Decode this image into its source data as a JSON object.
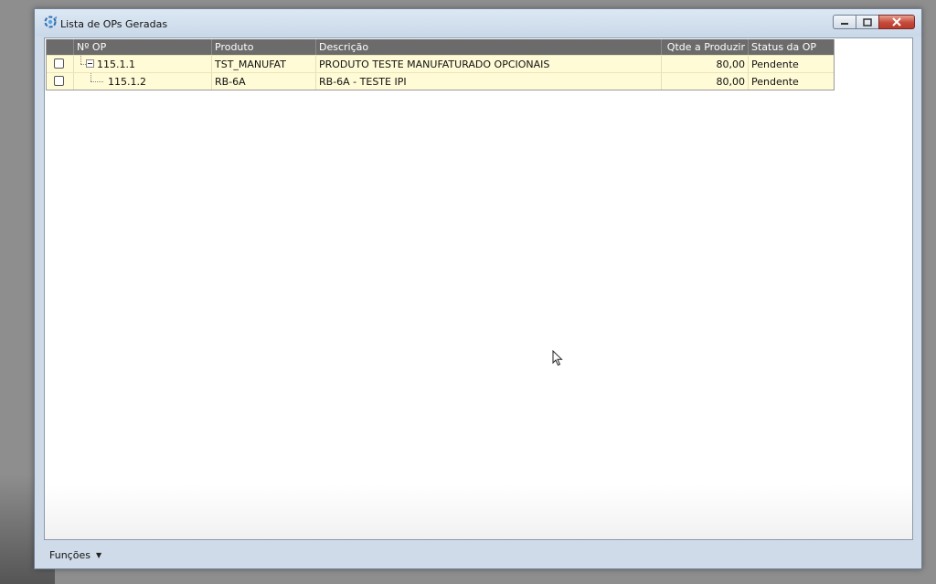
{
  "window": {
    "title": "Lista de OPs Geradas",
    "icon": "gear-refresh-icon"
  },
  "grid": {
    "columns": [
      "Nº OP",
      "Produto",
      "Descrição",
      "Qtde a Produzir",
      "Status da OP"
    ],
    "rows": [
      {
        "op": "115.1.1",
        "produto": "TST_MANUFAT",
        "descricao": "PRODUTO TESTE MANUFATURADO OPCIONAIS",
        "qtde": "80,00",
        "status": "Pendente",
        "checked": false,
        "level": 0
      },
      {
        "op": "115.1.2",
        "produto": "RB-6A",
        "descricao": "RB-6A - TESTE IPI",
        "qtde": "80,00",
        "status": "Pendente",
        "checked": false,
        "level": 1
      }
    ],
    "row_highlight": "#fffbd6",
    "header_bg": "#6b6b6b"
  },
  "footer": {
    "funcoes_label": "Funções"
  }
}
